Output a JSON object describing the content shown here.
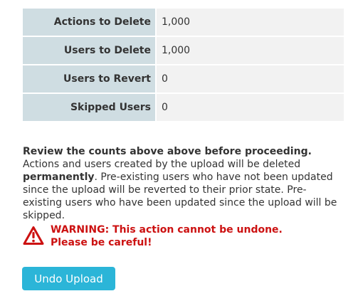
{
  "summary": {
    "rows": [
      {
        "label": "Actions to Delete",
        "value": "1,000"
      },
      {
        "label": "Users to Delete",
        "value": "1,000"
      },
      {
        "label": "Users to Revert",
        "value": "0"
      },
      {
        "label": "Skipped Users",
        "value": "0"
      }
    ]
  },
  "info": {
    "lead": "Review the counts above above before proceeding.",
    "part1": " Actions and users created by the upload will be deleted ",
    "emphasis": "permanently",
    "part2": ". Pre-existing users who have not been updated since the upload will be reverted to their prior state. Pre-existing users who have been updated since the upload will be skipped."
  },
  "warning": {
    "line1": "WARNING: This action cannot be undone.",
    "line2": "Please be careful!",
    "icon": "warning-triangle-icon",
    "color": "#cc1111"
  },
  "actions": {
    "undo_label": "Undo Upload",
    "button_color": "#2bb5d8"
  }
}
